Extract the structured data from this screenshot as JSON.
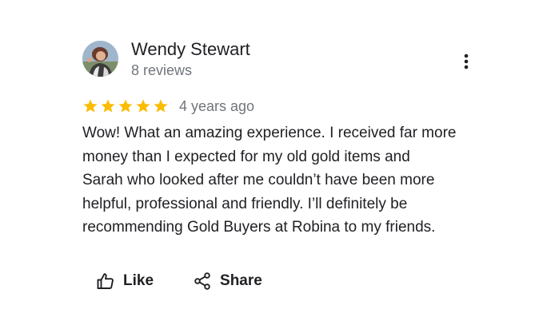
{
  "author": {
    "name": "Wendy Stewart",
    "review_count": "8 reviews",
    "avatar_icon": "avatar-photo"
  },
  "review": {
    "rating": 5,
    "rating_max": 5,
    "star_color": "#fbbc04",
    "date": "4 years ago",
    "text_lines": [
      "Wow! What an amazing experience. I received far more",
      "money than I expected for my old gold items and",
      "Sarah who looked after me couldn’t have been more",
      "helpful, professional and friendly. I’ll definitely be",
      "recommending Gold Buyers at Robina to my friends."
    ]
  },
  "menu": {
    "icon": "more-vert-icon"
  },
  "actions": {
    "like_label": "Like",
    "like_icon": "thumb-up-icon",
    "share_label": "Share",
    "share_icon": "share-icon"
  }
}
